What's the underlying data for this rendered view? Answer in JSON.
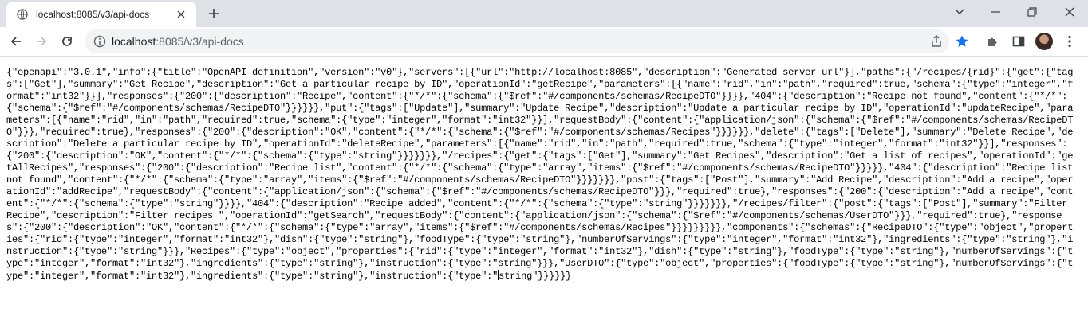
{
  "tab": {
    "title": "localhost:8085/v3/api-docs",
    "favicon": "globe-icon",
    "close_icon": "close-icon"
  },
  "toolbar": {
    "url_host": "localhost",
    "url_rest": ":8085/v3/api-docs",
    "site_info_icon": "info-icon",
    "share_icon": "share-icon",
    "bookmark_icon": "star-icon",
    "extensions_icon": "puzzle-icon",
    "sidepanel_icon": "side-panel-icon",
    "menu_icon": "kebab-menu-icon",
    "bookmark_color": "#1a73e8"
  },
  "content": {
    "json_before_caret": "{\"openapi\":\"3.0.1\",\"info\":{\"title\":\"OpenAPI definition\",\"version\":\"v0\"},\"servers\":[{\"url\":\"http://localhost:8085\",\"description\":\"Generated server url\"}],\"paths\":{\"/recipes/{rid}\":{\"get\":{\"tags\":[\"Get\"],\"summary\":\"Get Recipe\",\"description\":\"Get a particular recipe by ID\",\"operationId\":\"getRecipe\",\"parameters\":[{\"name\":\"rid\",\"in\":\"path\",\"required\":true,\"schema\":{\"type\":\"integer\",\"format\":\"int32\"}}],\"responses\":{\"200\":{\"description\":\"Recipe\",\"content\":{\"*/*\":{\"schema\":{\"$ref\":\"#/components/schemas/RecipeDTO\"}}}},\"404\":{\"description\":\"Recipe not found\",\"content\":{\"*/*\":{\"schema\":{\"$ref\":\"#/components/schemas/RecipeDTO\"}}}}}},\"put\":{\"tags\":[\"Update\"],\"summary\":\"Update Recipe\",\"description\":\"Update a particular recipe by ID\",\"operationId\":\"updateRecipe\",\"parameters\":[{\"name\":\"rid\",\"in\":\"path\",\"required\":true,\"schema\":{\"type\":\"integer\",\"format\":\"int32\"}}],\"requestBody\":{\"content\":{\"application/json\":{\"schema\":{\"$ref\":\"#/components/schemas/RecipeDTO\"}}},\"required\":true},\"responses\":{\"200\":{\"description\":\"OK\",\"content\":{\"*/*\":{\"schema\":{\"$ref\":\"#/components/schemas/Recipes\"}}}}}},\"delete\":{\"tags\":[\"Delete\"],\"summary\":\"Delete Recipe\",\"description\":\"Delete a particular recipe by ID\",\"operationId\":\"deleteRecipe\",\"parameters\":[{\"name\":\"rid\",\"in\":\"path\",\"required\":true,\"schema\":{\"type\":\"integer\",\"format\":\"int32\"}}],\"responses\":{\"200\":{\"description\":\"OK\",\"content\":{\"*/*\":{\"schema\":{\"type\":\"string\"}}}}}}},\"/recipes\":{\"get\":{\"tags\":[\"Get\"],\"summary\":\"Get Recipes\",\"description\":\"Get a list of recipes\",\"operationId\":\"getAllRecipes\",\"responses\":{\"200\":{\"description\":\"Recipe list\",\"content\":{\"*/*\":{\"schema\":{\"type\":\"array\",\"items\":{\"$ref\":\"#/components/schemas/RecipeDTO\"}}}}},\"404\":{\"description\":\"Recipe list not found\",\"content\":{\"*/*\":{\"schema\":{\"type\":\"array\",\"items\":{\"$ref\":\"#/components/schemas/RecipeDTO\"}}}}}}},\"post\":{\"tags\":[\"Post\"],\"summary\":\"Add Recipe\",\"description\":\"Add a recipe\",\"operationId\":\"addRecipe\",\"requestBody\":{\"content\":{\"application/json\":{\"schema\":{\"$ref\":\"#/components/schemas/RecipeDTO\"}}},\"required\":true},\"responses\":{\"200\":{\"description\":\"Add a recipe\",\"content\":{\"*/*\":{\"schema\":{\"type\":\"string\"}}}},\"404\":{\"description\":\"Recipe added\",\"content\":{\"*/*\":{\"schema\":{\"type\":\"string\"}}}}}}},\"/recipes/filter\":{\"post\":{\"tags\":[\"Post\"],\"summary\":\"Filter Recipe\",\"description\":\"Filter recipes \",\"operationId\":\"getSearch\",\"requestBody\":{\"content\":{\"application/json\":{\"schema\":{\"$ref\":\"#/components/schemas/UserDTO\"}}},\"required\":true},\"responses\":{\"200\":{\"description\":\"OK\",\"content\":{\"*/*\":{\"schema\":{\"type\":\"array\",\"items\":{\"$ref\":\"#/components/schemas/Recipes\"}}}}}}}}},\"components\":{\"schemas\":{\"RecipeDTO\":{\"type\":\"object\",\"properties\":{\"rid\":{\"type\":\"integer\",\"format\":\"int32\"},\"dish\":{\"type\":\"string\"},\"foodType\":{\"type\":\"string\"},\"numberOfServings\":{\"type\":\"integer\",\"format\":\"int32\"},\"ingredients\":{\"type\":\"string\"},\"instruction\":{\"type\":\"string\"}}},\"Recipes\":{\"type\":\"object\",\"properties\":{\"rid\":{\"type\":\"integer\",\"format\":\"int32\"},\"dish\":{\"type\":\"string\"},\"foodType\":{\"type\":\"string\"},\"numberOfServings\":{\"type\":\"integer\",\"format\":\"int32\"},\"ingredients\":{\"type\":\"string\"},\"instruction\":{\"type\":\"string\"}}},\"UserDTO\":{\"type\":\"object\",\"properties\":{\"foodType\":{\"type\":\"string\"},\"numberOfServings\":{\"type\":\"integer\",\"format\":\"int32\"},\"ingredients\":{\"type\":\"string\"},\"instruction\":{\"type\":\"",
    "json_after_caret": "string\"}}}}}}"
  }
}
